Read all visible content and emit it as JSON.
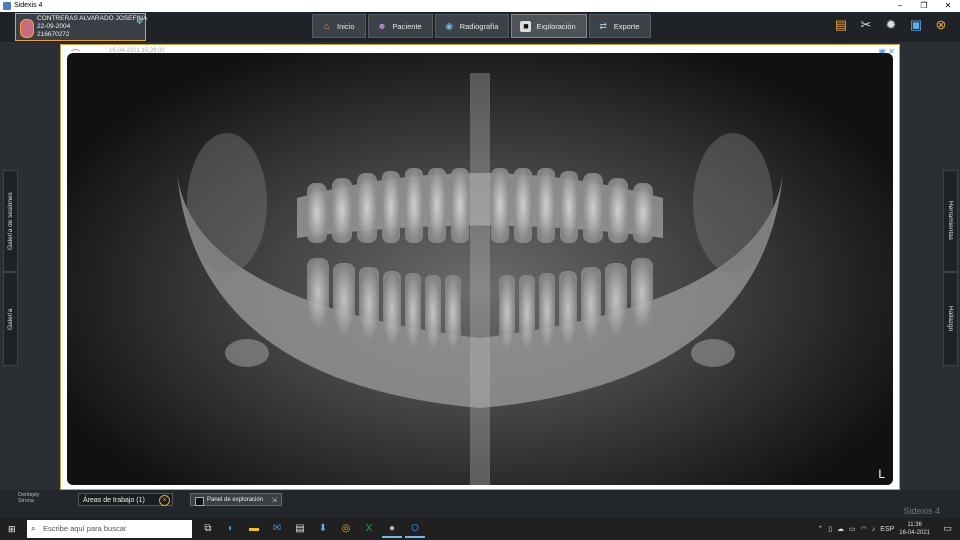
{
  "window": {
    "title": "Sidexis 4",
    "minimize": "–",
    "maximize": "❐",
    "close": "✕"
  },
  "patient": {
    "name": "CONTRERAS ALVARADO JOSEFINA",
    "dob": "22-09-2004",
    "id": "216670272"
  },
  "nav": {
    "items": [
      {
        "label": "Inicio",
        "icon": "home-icon",
        "glyph": "⌂",
        "color": "#c9a27a"
      },
      {
        "label": "Paciente",
        "icon": "patient-icon",
        "glyph": "☻",
        "color": "#b08ec9"
      },
      {
        "label": "Radiografía",
        "icon": "xray-icon",
        "glyph": "◉",
        "color": "#7ab8e0"
      },
      {
        "label": "Exploración",
        "icon": "exploration-icon",
        "glyph": "■",
        "color": "#111111"
      },
      {
        "label": "Exporte",
        "icon": "export-icon",
        "glyph": "⇄",
        "color": "#9fc7e8"
      }
    ]
  },
  "topicons": [
    {
      "name": "notes-icon",
      "glyph": "▤",
      "color": "#e8a33a"
    },
    {
      "name": "tools-icon",
      "glyph": "✂",
      "color": "#ddd"
    },
    {
      "name": "settings-icon",
      "glyph": "✹",
      "color": "#ddd"
    },
    {
      "name": "window-icon",
      "glyph": "▣",
      "color": "#5fb0e8"
    },
    {
      "name": "close-circle-icon",
      "glyph": "⊗",
      "color": "#e8a33a"
    }
  ],
  "sidetabs": {
    "left_top": "Galería de sesiones",
    "left_bottom": "Galería",
    "right_top": "Herramientas",
    "right_bottom": "Hallazgo"
  },
  "image": {
    "timestamp": "16-04-2021 15:28:00",
    "orientation": "L"
  },
  "bottom": {
    "brand_line1": "Dentsply",
    "brand_line2": "Sirona",
    "areas_label": "Áreas de trabajo (1)",
    "panel_label": "Panel de exploración",
    "app_name": "Sidexis 4"
  },
  "taskbar": {
    "search_placeholder": "Escribe aquí para buscar",
    "language": "ESP",
    "time": "11:36",
    "date": "16-04-2021"
  }
}
